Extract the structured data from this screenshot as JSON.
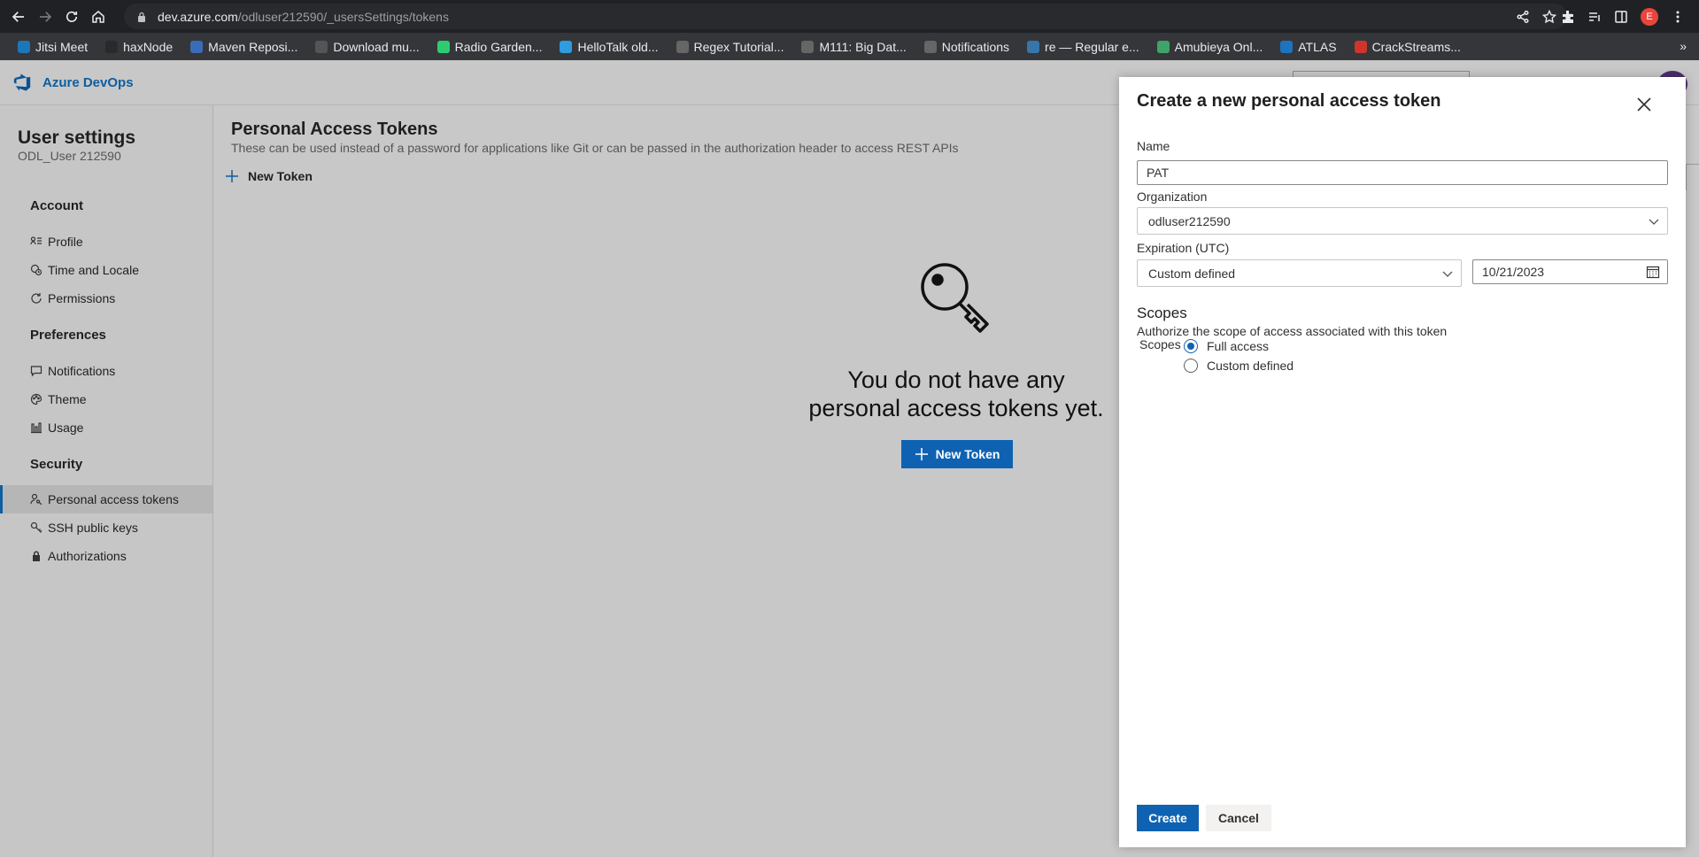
{
  "browser": {
    "url_host": "dev.azure.com",
    "url_path": "/odluser212590/_usersSettings/tokens",
    "profile_initial": "E",
    "bookmarks": [
      {
        "label": "Jitsi Meet",
        "color": "#1d76ba"
      },
      {
        "label": "haxNode",
        "color": "#2a2a2a"
      },
      {
        "label": "Maven Reposi...",
        "color": "#3b6cb7"
      },
      {
        "label": "Download mu...",
        "color": "#555555"
      },
      {
        "label": "Radio Garden...",
        "color": "#2ecc71"
      },
      {
        "label": "HelloTalk old...",
        "color": "#2f9be0"
      },
      {
        "label": "Regex Tutorial...",
        "color": "#666666"
      },
      {
        "label": "M111: Big Dat...",
        "color": "#666666"
      },
      {
        "label": "Notifications",
        "color": "#666666"
      },
      {
        "label": "re — Regular e...",
        "color": "#3776ab"
      },
      {
        "label": "Amubieya Onl...",
        "color": "#3fa46a"
      },
      {
        "label": "ATLAS",
        "color": "#1e73be"
      },
      {
        "label": "CrackStreams...",
        "color": "#d0342c"
      }
    ],
    "bookmarks_more": "»"
  },
  "app": {
    "title": "Azure DevOps"
  },
  "sidebar": {
    "title": "User settings",
    "subtitle": "ODL_User 212590",
    "sections": {
      "account": "Account",
      "preferences": "Preferences",
      "security": "Security"
    },
    "items": {
      "profile": "Profile",
      "time_locale": "Time and Locale",
      "permissions": "Permissions",
      "notifications": "Notifications",
      "theme": "Theme",
      "usage": "Usage",
      "pat": "Personal access tokens",
      "ssh": "SSH public keys",
      "authorizations": "Authorizations"
    }
  },
  "main": {
    "title": "Personal Access Tokens",
    "description": "These can be used instead of a password for applications like Git or can be passed in the authorization header to access REST APIs",
    "new_token_link": "New Token",
    "empty_line1": "You do not have any",
    "empty_line2": "personal access tokens yet.",
    "new_token_button": "New Token"
  },
  "dialog": {
    "title": "Create a new personal access token",
    "name_label": "Name",
    "name_value": "PAT",
    "org_label": "Organization",
    "org_value": "odluser212590",
    "expiration_label": "Expiration (UTC)",
    "expiration_value": "Custom defined",
    "date_value": "10/21/2023",
    "scopes_heading": "Scopes",
    "scopes_desc": "Authorize the scope of access associated with this token",
    "scopes_label": "Scopes",
    "scope_full": "Full access",
    "scope_custom": "Custom defined",
    "create": "Create",
    "cancel": "Cancel"
  },
  "colors": {
    "accent": "#0f62b2",
    "brand": "#0f5ea0"
  }
}
